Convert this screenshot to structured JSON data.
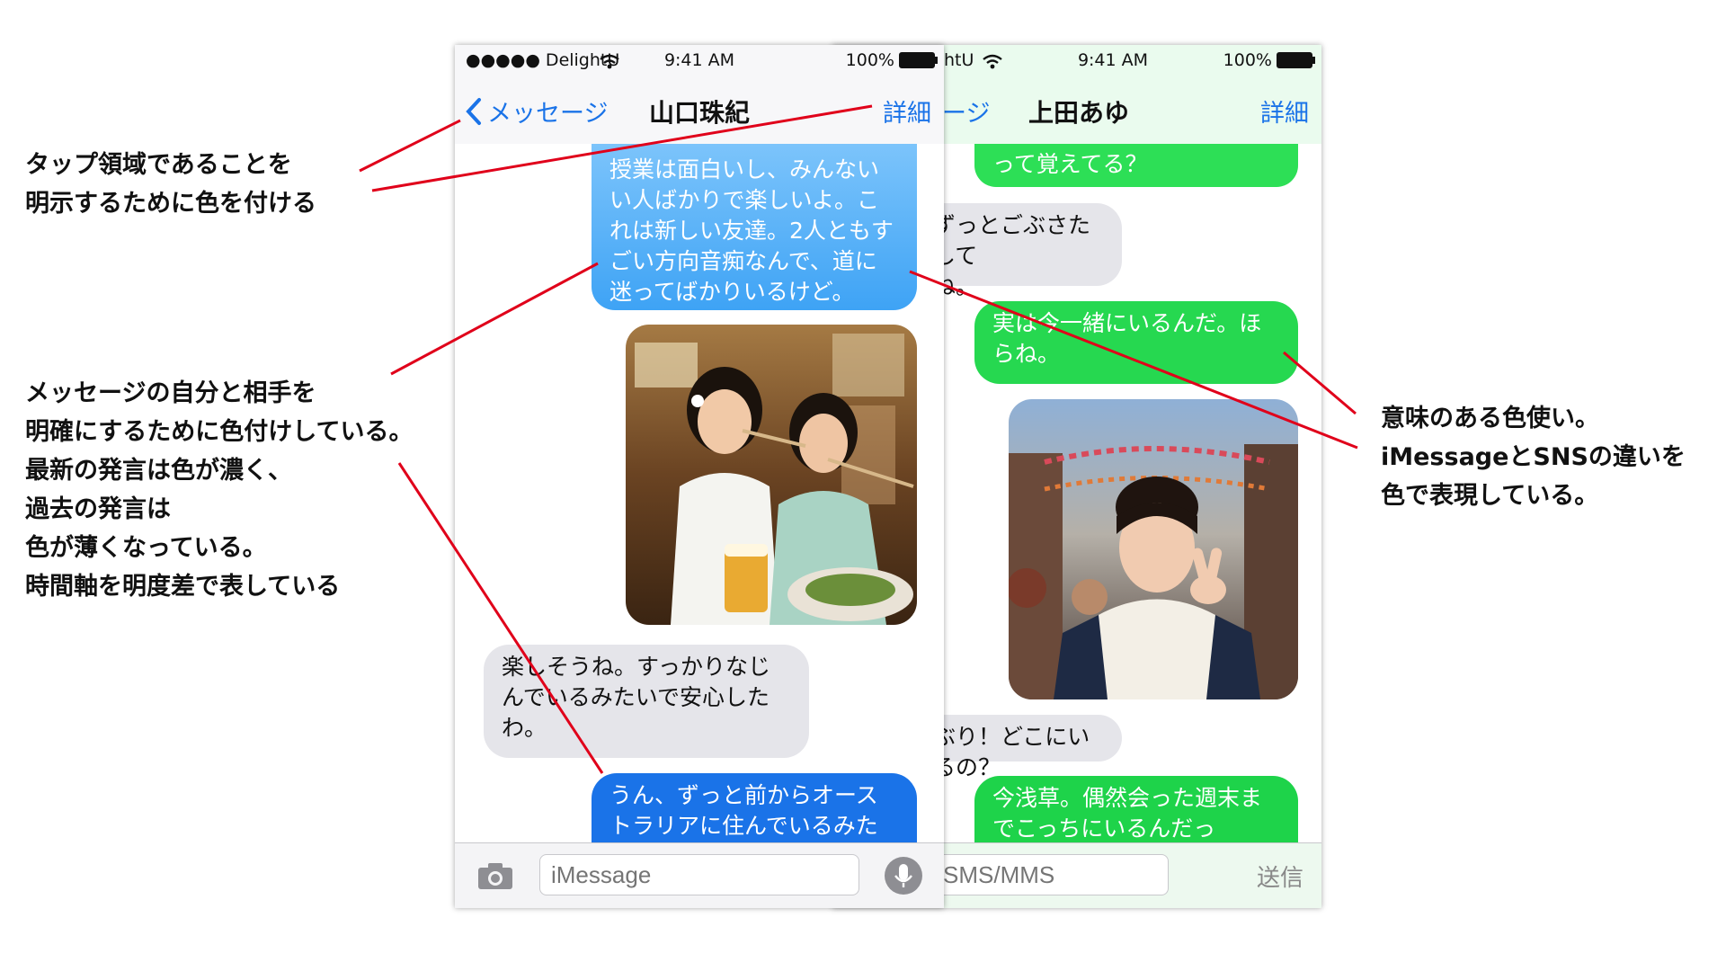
{
  "left_phone": {
    "status": {
      "carrier": "●●●●● DelightU",
      "time": "9:41 AM",
      "battery": "100%"
    },
    "nav": {
      "back_label": "メッセージ",
      "title": "山口珠紀",
      "detail_label": "詳細"
    },
    "messages": [
      {
        "type": "sent",
        "text": "授業は面白いし、みんないい人ばかりで楽しいよ。これは新しい友達。2人ともすごい方向音痴なんで、道に迷ってばかりいるけど。"
      },
      {
        "type": "recv",
        "text": "楽しそうね。すっかりなじんでいるみたいで安心したわ。"
      },
      {
        "type": "sent",
        "text": "うん、ずっと前からオーストラリアに住んでいるみた"
      }
    ],
    "input": {
      "placeholder": "iMessage"
    }
  },
  "right_phone": {
    "status": {
      "carrier": "htU",
      "time": "9:41 AM",
      "battery": "100%"
    },
    "nav": {
      "back_label": "ージ",
      "title": "上田あゆ",
      "detail_label": "詳細"
    },
    "messages": [
      {
        "type": "sent",
        "text": "って覚えてる？"
      },
      {
        "type": "recv",
        "text": "ずっとごぶさたして\nね。"
      },
      {
        "type": "sent",
        "text": "実は今一緒にいるんだ。ほらね。"
      },
      {
        "type": "recv",
        "text": "ぶり！どこにいるの？"
      },
      {
        "type": "sent",
        "text": "今浅草。偶然会った週末までこっちにいるんだっ"
      }
    ],
    "input": {
      "placeholder": "SMS/MMS",
      "send_label": "送信"
    }
  },
  "callouts": {
    "tap_area": [
      "タップ領域であることを",
      "明示するために色を付ける"
    ],
    "self_other": [
      "メッセージの自分と相手を",
      "明確にするために色付けしている。",
      "最新の発言は色が濃く、",
      "過去の発言は",
      "色が薄くなっている。",
      "時間軸を明度差で表している"
    ],
    "meaningful_color": [
      "意味のある色使い。",
      "iMessageとSNSの違いを",
      "色で表現している。"
    ]
  },
  "colors": {
    "imessage_blue": "#1a73e8",
    "sms_green": "#1ed34a",
    "received_gray": "#e5e5ea",
    "annotation_line": "#e0001a"
  },
  "icons": {
    "back": "chevron-left-icon",
    "wifi": "wifi-icon",
    "battery": "battery-icon",
    "camera": "camera-icon",
    "mic": "microphone-icon"
  }
}
